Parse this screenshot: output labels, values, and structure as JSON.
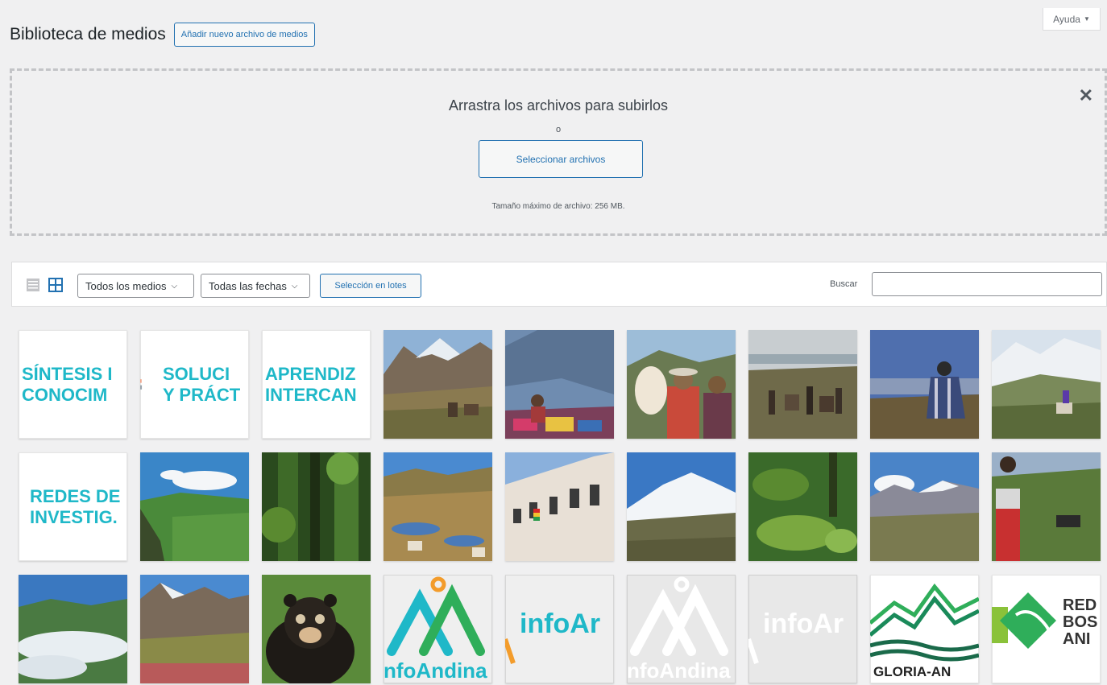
{
  "help": {
    "label": "Ayuda",
    "arrow": "▼"
  },
  "header": {
    "title": "Biblioteca de medios",
    "add_new": "Añadir nuevo archivo de medios"
  },
  "uploader": {
    "title": "Arrastra los archivos para subirlos",
    "or": "o",
    "select_button": "Seleccionar archivos",
    "max_size": "Tamaño máximo de archivo: 256 MB.",
    "close_glyph": "✕"
  },
  "toolbar": {
    "media_filter": "Todos los medios",
    "date_filter": "Todas las fechas",
    "bulk_select": "Selección en lotes",
    "search_label": "Buscar",
    "search_value": "",
    "chevron": "⌵"
  },
  "colors": {
    "accent": "#2271b1",
    "teal": "#1fb8c8",
    "orange": "#f39c2b",
    "green": "#2fae5a"
  },
  "media": {
    "text_tiles": [
      {
        "line1": "SÍNTESIS I",
        "line2": "CONOCIM"
      },
      {
        "line1": "SOLUCI",
        "line2": "Y PRÁCT"
      },
      {
        "line1": "APRENDIZ",
        "line2": "INTERCAN"
      },
      {
        "line1": "REDES DE",
        "line2": "INVESTIG."
      }
    ],
    "logos": {
      "infoandina_a": "nfoAndina",
      "infoar_a": "infoAr",
      "infoandina_b": "nfoAndina",
      "infoar_b": "infoAr",
      "gloria": "GLORIA-AN",
      "redbos": "RED\nBOS\nANI"
    }
  }
}
